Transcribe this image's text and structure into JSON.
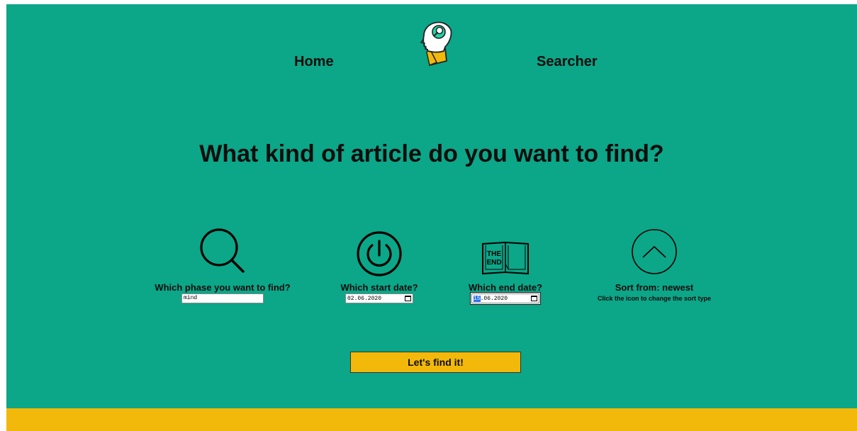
{
  "nav": {
    "home_label": "Home",
    "searcher_label": "Searcher"
  },
  "headline": "What kind of article do you want to find?",
  "filters": {
    "phrase": {
      "label": "Which phase you want to find?",
      "value": "mind",
      "icon": "magnifier-icon"
    },
    "start_date": {
      "label": "Which start date?",
      "value": "02.06.2020",
      "icon": "power-icon"
    },
    "end_date": {
      "label": "Which end date?",
      "day": "15",
      "rest": ".06.2020",
      "icon": "the-end-book-icon",
      "icon_text_line1": "THE",
      "icon_text_line2": "END"
    },
    "sort": {
      "label": "Sort from: newest",
      "hint": "Click the icon to change the sort type",
      "icon": "chevron-up-circle-icon"
    }
  },
  "submit_label": "Let's find it!",
  "colors": {
    "background": "#0ca688",
    "accent": "#f2b90b",
    "text": "#0d0d0d"
  }
}
